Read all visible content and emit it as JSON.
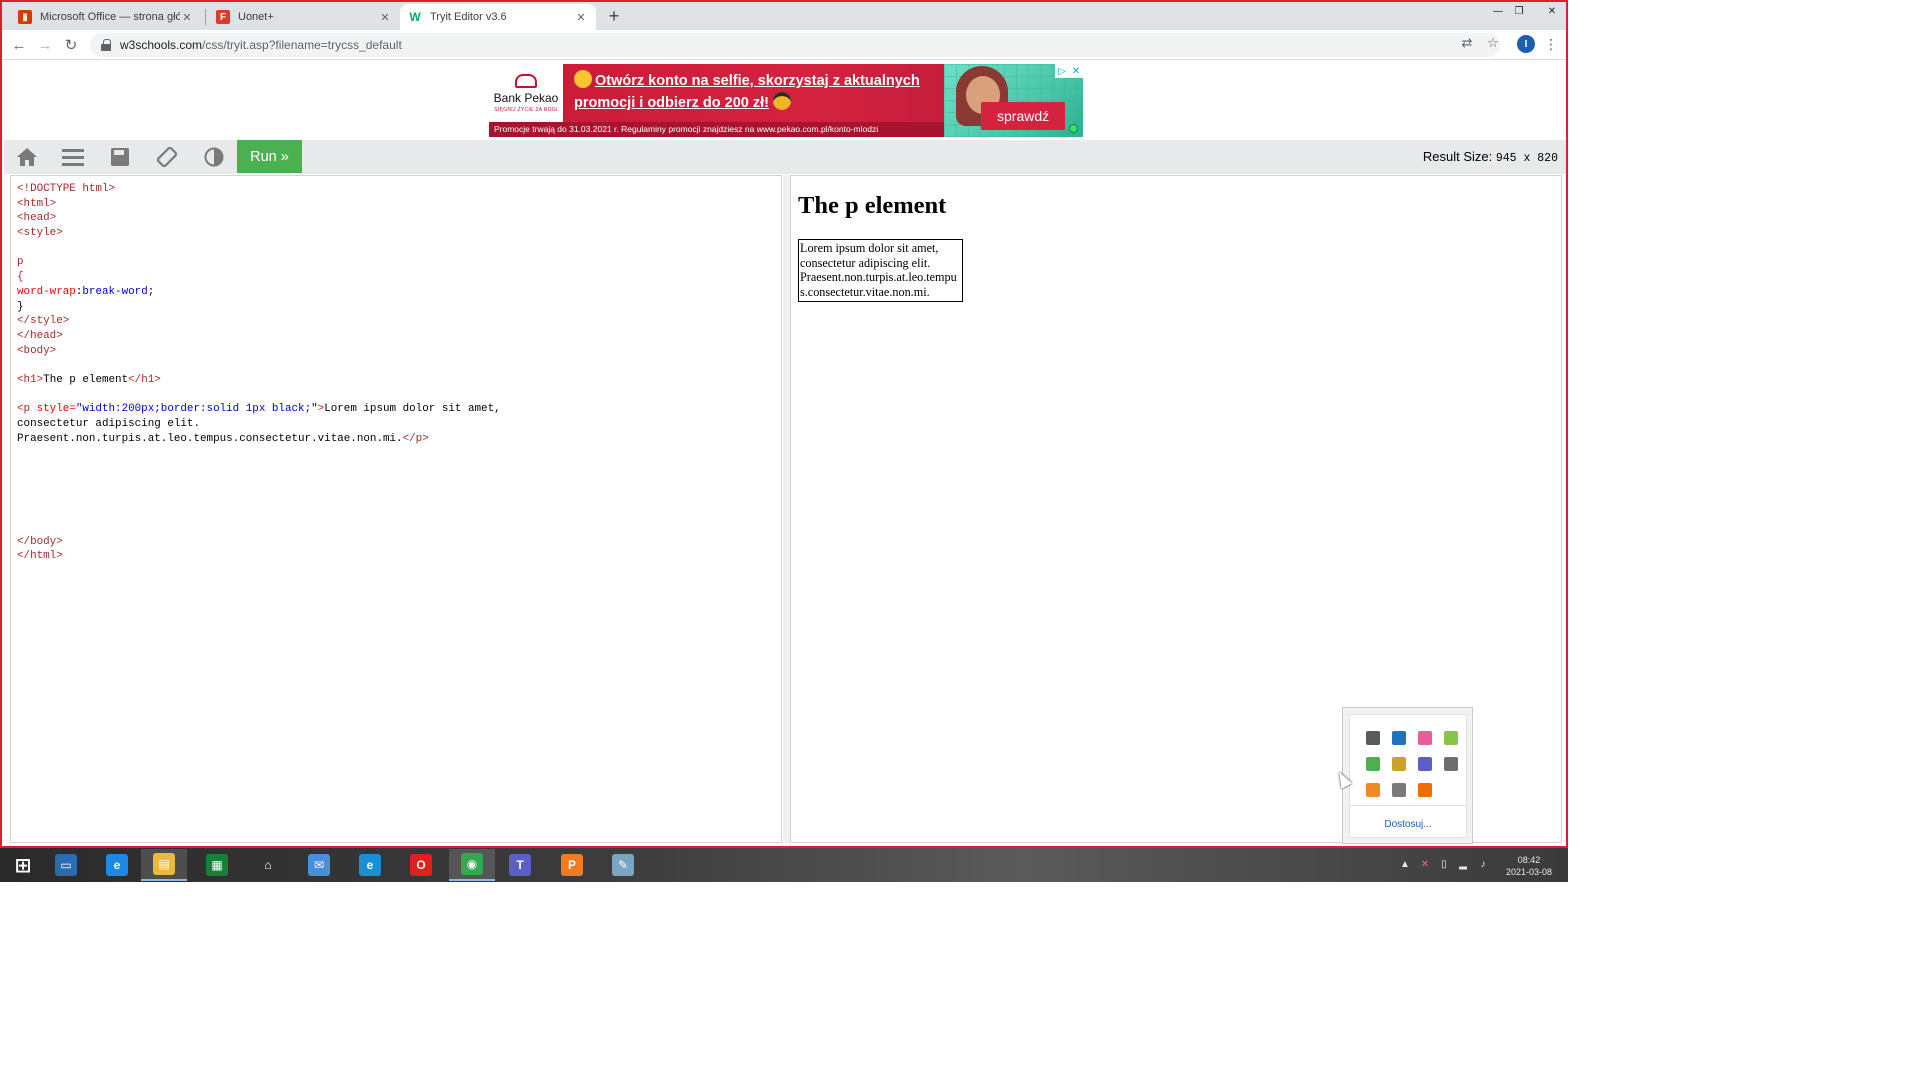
{
  "browser": {
    "tabs": [
      {
        "title": "Microsoft Office — strona główna",
        "favicon_color": "#d83b01",
        "active": false
      },
      {
        "title": "Uonet+",
        "favicon_color": "#e03a2a",
        "active": false
      },
      {
        "title": "Tryit Editor v3.6",
        "favicon_color": "#04aa6d",
        "active": true
      }
    ],
    "new_tab_glyph": "+",
    "url": {
      "domain": "w3schools.com",
      "path": "/css/tryit.asp?filename=trycss_default"
    },
    "profile_initial": "I",
    "window_controls": [
      "—",
      "❐",
      "✕"
    ]
  },
  "ad": {
    "brand": "Bank Pekao",
    "tagline": "SIĘGNIJ ŻYCIE ZA ROGI",
    "headline_1": "Otwórz konto na selfie, skorzystaj z aktualnych",
    "headline_2": "promocji i odbierz do 200 zł!",
    "cta": "sprawdź",
    "footer": "Promocje trwają do 31.03.2021 r. Regulaminy promocji znajdziesz na www.pekao.com.pl/konto-mlodzi",
    "choices": [
      "▷",
      "✕"
    ]
  },
  "w3bar": {
    "icons": [
      "home-icon",
      "menu-icon",
      "save-icon",
      "rotate-icon",
      "theme-icon"
    ],
    "run_label": "Run »",
    "result_size_label": "Result Size:",
    "result_size_value": "945 x 820"
  },
  "code_lines": [
    [
      [
        "t-brown",
        "<!DOCTYPE html>"
      ]
    ],
    [
      [
        "t-brown",
        "<html>"
      ]
    ],
    [
      [
        "t-brown",
        "<head>"
      ]
    ],
    [
      [
        "t-brown",
        "<style>"
      ]
    ],
    [],
    [
      [
        "t-brown",
        "p"
      ]
    ],
    [
      [
        "t-brown",
        "{"
      ]
    ],
    [
      [
        "t-red",
        "word-wrap"
      ],
      [
        "",
        ":"
      ],
      [
        "t-blue",
        "break-word"
      ],
      [
        "",
        ";"
      ]
    ],
    [
      [
        "",
        "}"
      ]
    ],
    [
      [
        "t-brown",
        "</style>"
      ]
    ],
    [
      [
        "t-brown",
        "</head>"
      ]
    ],
    [
      [
        "t-brown",
        "<body>"
      ]
    ],
    [],
    [
      [
        "t-brown",
        "<h1>"
      ],
      [
        "",
        "The p element"
      ],
      [
        "t-brown",
        "</h1>"
      ]
    ],
    [],
    [
      [
        "t-brown",
        "<p "
      ],
      [
        "t-attr",
        "style="
      ],
      [
        "t-val",
        "\"width:200px;border:solid 1px black;\""
      ],
      [
        "t-brown",
        ">"
      ],
      [
        "",
        "Lorem ipsum dolor sit amet,"
      ]
    ],
    [
      [
        "",
        "consectetur adipiscing elit."
      ]
    ],
    [
      [
        "",
        "Praesent.non.turpis.at.leo.tempus.consectetur.vitae.non.mi."
      ],
      [
        "t-brown",
        "</p>"
      ]
    ],
    [],
    [],
    [],
    [],
    [],
    [],
    [
      [
        "t-brown",
        "</body>"
      ]
    ],
    [
      [
        "t-brown",
        "</html>"
      ]
    ]
  ],
  "result": {
    "h1": "The p element",
    "p": "Lorem ipsum dolor sit amet, consectetur adipiscing elit. Praesent.non.turpis.at.leo.tempus.consectetur.vitae.non.mi."
  },
  "tray_popup": {
    "icons": [
      {
        "name": "display-icon",
        "color": "#5a5a5a"
      },
      {
        "name": "network-drive-icon",
        "color": "#1e73be"
      },
      {
        "name": "colorful-app-icon",
        "color": "#e85d9a"
      },
      {
        "name": "green-yellow-icon",
        "color": "#8bc34a"
      },
      {
        "name": "shield-check-icon",
        "color": "#4caf50"
      },
      {
        "name": "package-icon",
        "color": "#c9a227"
      },
      {
        "name": "teams-icon",
        "color": "#5b5fc7"
      },
      {
        "name": "camera-icon",
        "color": "#6e6e6e"
      },
      {
        "name": "orange-update-icon",
        "color": "#f08a24"
      },
      {
        "name": "printer-icon",
        "color": "#7a7a7a"
      },
      {
        "name": "orange-z-icon",
        "color": "#ef6c00"
      }
    ],
    "customize_label": "Dostosuj..."
  },
  "taskbar": {
    "apps": [
      {
        "name": "start-button-icon",
        "glyph": "⊞",
        "color": "transparent"
      },
      {
        "name": "lenovo-monitor-icon",
        "glyph": "▭",
        "color": "#2b6cb0"
      },
      {
        "name": "internet-explorer-icon",
        "glyph": "e",
        "color": "#1e88e5"
      },
      {
        "name": "file-explorer-icon",
        "glyph": "▤",
        "color": "#e8b93a"
      },
      {
        "name": "store-icon",
        "glyph": "▦",
        "color": "#188038"
      },
      {
        "name": "home-app-icon",
        "glyph": "⌂",
        "color": "transparent"
      },
      {
        "name": "mail-icon",
        "glyph": "✉",
        "color": "#4a90d9"
      },
      {
        "name": "edge-icon",
        "glyph": "e",
        "color": "#1b8fd6"
      },
      {
        "name": "opera-icon",
        "glyph": "O",
        "color": "#e0201b"
      },
      {
        "name": "chrome-icon",
        "glyph": "◉",
        "color": "#34a853"
      },
      {
        "name": "teams-icon",
        "glyph": "T",
        "color": "#5b5fc7"
      },
      {
        "name": "pdf-app-icon",
        "glyph": "P",
        "color": "#f07b22"
      },
      {
        "name": "notepad-icon",
        "glyph": "✎",
        "color": "#7aa6c2"
      }
    ],
    "clock_time": "08:42",
    "clock_date": "2021-03-08"
  }
}
